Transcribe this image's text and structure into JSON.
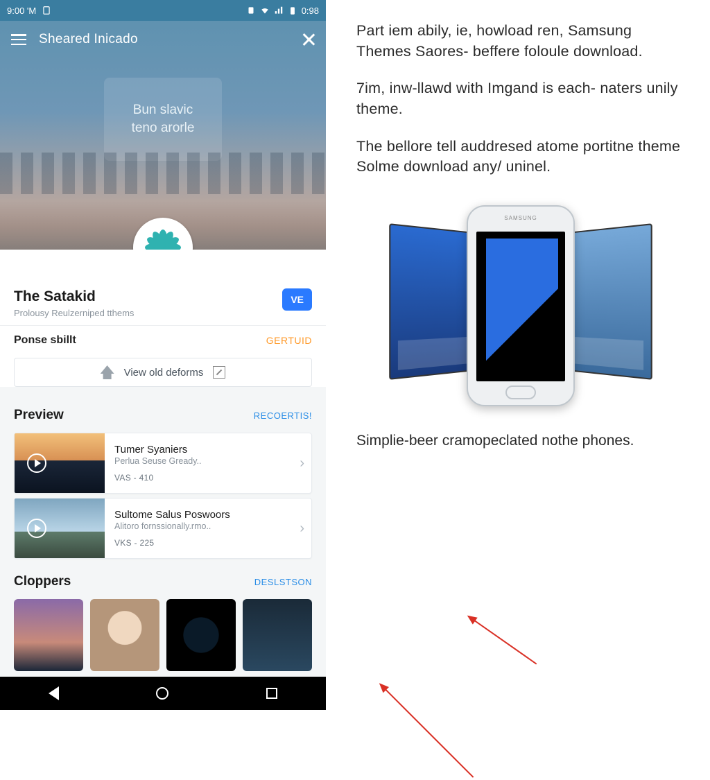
{
  "statusbar": {
    "time_left": "9:00 'M",
    "battery_right": "0:98"
  },
  "hero": {
    "page_title": "Sheared Inicado",
    "hero_box_line1": "Bun slavic",
    "hero_box_line2": "teno arorle"
  },
  "detail": {
    "title": "The Satakid",
    "subtitle": "Prolousy Reulzerniped tthems",
    "ve_label": "VE",
    "ponse_label": "Ponse sbillt",
    "ponse_link": "GERTUID",
    "view_old": "View old deforms"
  },
  "preview": {
    "heading": "Preview",
    "link": "RECOERTIS!",
    "items": [
      {
        "title": "Tumer Syaniers",
        "subtitle": "Perlua Seuse Gready..",
        "meta": "VAS - 410"
      },
      {
        "title": "Sultome Salus Poswoors",
        "subtitle": "Alitoro fornssionally.rmo..",
        "meta": "VKS - 225"
      }
    ]
  },
  "cloppers": {
    "heading": "Cloppers",
    "link": "DESLSTSON"
  },
  "right": {
    "p1": "Part iem abily, ie, howload ren, Samsung Themes Saores- beffere foloule download.",
    "p2": "7im, inw-llawd with Imgand is each- naters unily theme.",
    "p3": "The bellore tell auddresed atome portitne theme Solme download any/ uninel.",
    "phone_brand": "SAMSUNG",
    "caption": "Simplie-beer cramopeclated nothe phones."
  }
}
